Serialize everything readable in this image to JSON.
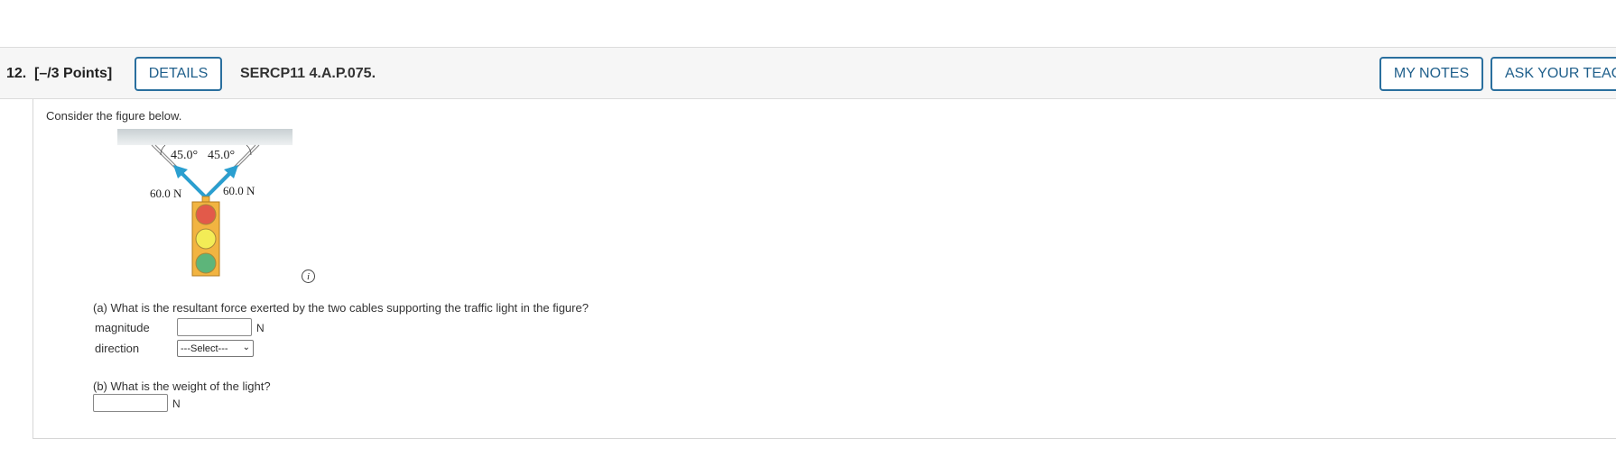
{
  "header": {
    "number": "12.",
    "points": "[–/3 Points]",
    "details_label": "DETAILS",
    "code": "SERCP11 4.A.P.075.",
    "notes_label": "MY NOTES",
    "ask_label": "ASK YOUR TEAC"
  },
  "intro": "Consider the figure below.",
  "figure": {
    "angle_left": "45.0°",
    "angle_right": "45.0°",
    "force_left": "60.0 N",
    "force_right": "60.0 N",
    "info_icon": "i"
  },
  "part_a": {
    "question": "(a) What is the resultant force exerted by the two cables supporting the traffic light in the figure?",
    "magnitude_label": "magnitude",
    "magnitude_value": "",
    "magnitude_unit": "N",
    "direction_label": "direction",
    "direction_selected": "---Select---"
  },
  "part_b": {
    "question": "(b) What is the weight of the light?",
    "value": "",
    "unit": "N"
  },
  "colors": {
    "button_border": "#2a6f9e",
    "arrow": "#2a9fd0",
    "light_housing": "#f2b441",
    "red_lamp": "#e25a4a",
    "yellow_lamp": "#f3ec56",
    "green_lamp": "#5db57a"
  }
}
